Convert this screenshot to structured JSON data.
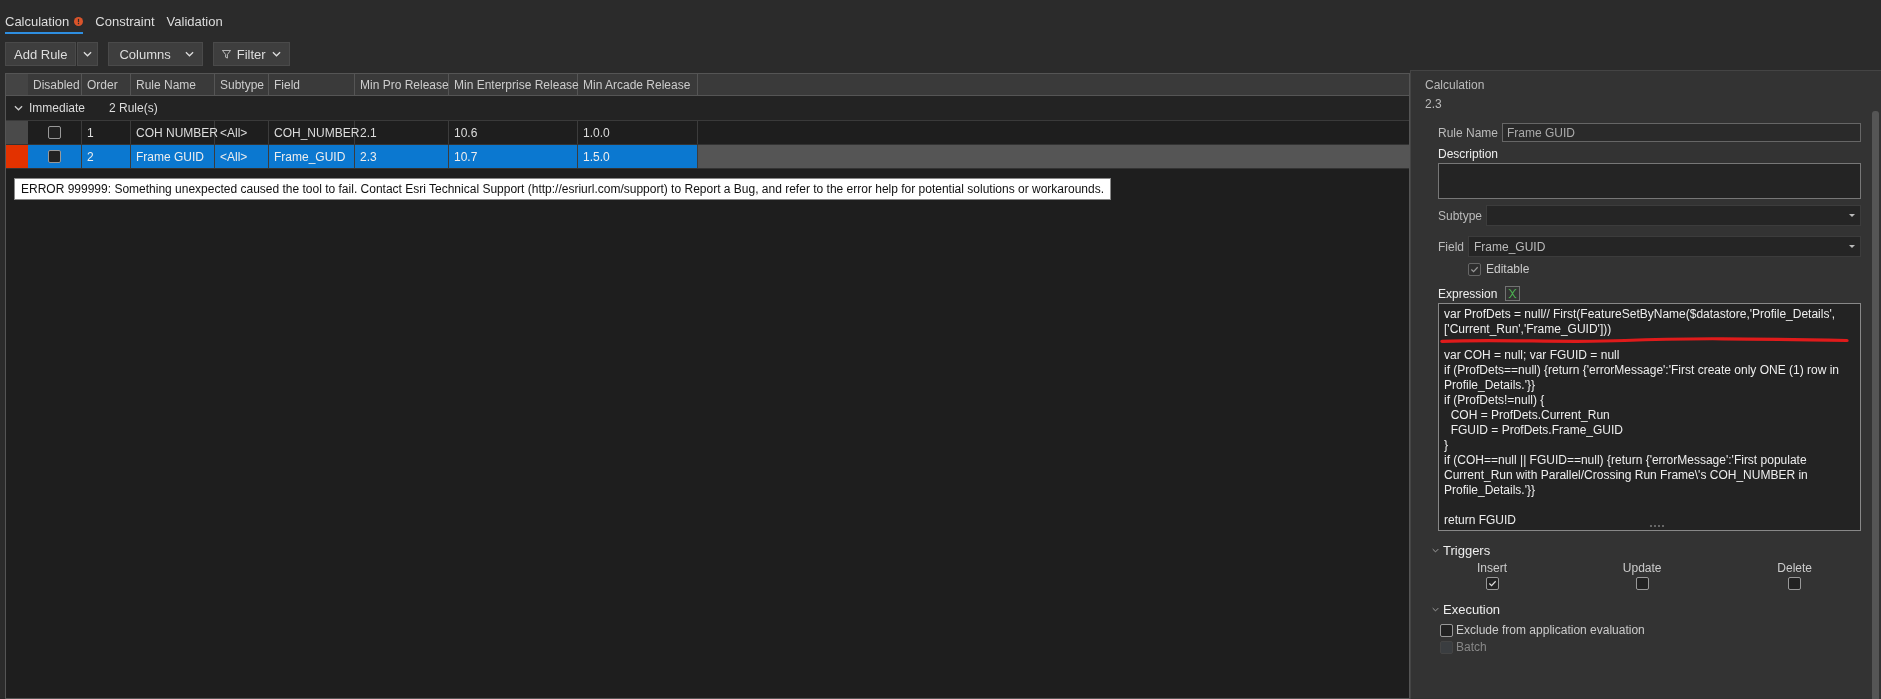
{
  "tabs": [
    {
      "label": "Calculation",
      "selected": true,
      "has_error": true
    },
    {
      "label": "Constraint",
      "selected": false,
      "has_error": false
    },
    {
      "label": "Validation",
      "selected": false,
      "has_error": false
    }
  ],
  "toolbar": [
    {
      "label": "Add Rule",
      "kind": "split"
    },
    {
      "label": "Columns",
      "kind": "dropdown"
    },
    {
      "label": "Filter",
      "kind": "filter"
    }
  ],
  "grid": {
    "checkbox_column": "Disabled",
    "columns": [
      "Order",
      "Rule Name",
      "Subtype",
      "Field",
      "Min Pro Release",
      "Min Enterprise Release",
      "Min Arcade Release"
    ],
    "group": {
      "label": "Immediate",
      "count": "2 Rule(s)",
      "expanded": true
    },
    "rows": [
      {
        "disabled": false,
        "selected": false,
        "error": false,
        "cells": [
          "1",
          "COH NUMBER",
          "<All>",
          "COH_NUMBER",
          "2.1",
          "10.6",
          "1.0.0"
        ]
      },
      {
        "disabled": false,
        "selected": true,
        "error": true,
        "cells": [
          "2",
          "Frame GUID",
          "<All>",
          "Frame_GUID",
          "2.3",
          "10.7",
          "1.5.0"
        ]
      }
    ]
  },
  "tooltip": "ERROR 999999: Something unexpected caused the tool to fail. Contact Esri Technical Support (http://esriurl.com/support) to Report a Bug, and refer to the error help for potential solutions or workarounds.",
  "details": {
    "title": "Calculation",
    "version": "2.3",
    "rule_name_label": "Rule Name",
    "rule_name": "Frame GUID",
    "description_label": "Description",
    "subtype_label": "Subtype",
    "field_label": "Field",
    "field": "Frame_GUID",
    "editable": {
      "label": "Editable",
      "checked": true
    },
    "expression_label": "Expression",
    "expression_blocks": [
      {
        "underlined": true,
        "lines": [
          "var ProfDets = null// First(FeatureSetByName($datastore,'Profile_Details', ['Current_Run','Frame_GUID']))"
        ]
      },
      {
        "underlined": false,
        "lines": [
          "var COH = null; var FGUID = null",
          "if (ProfDets==null) {return {'errorMessage':'First create only ONE (1) row in Profile_Details.'}}",
          "if (ProfDets!=null) {",
          "  COH = ProfDets.Current_Run",
          "  FGUID = ProfDets.Frame_GUID",
          "}",
          "if (COH==null || FGUID==null) {return {'errorMessage':'First populate Current_Run with Parallel/Crossing Run Frame\\'s COH_NUMBER in Profile_Details.'}}"
        ]
      },
      {
        "underlined": false,
        "lines": [
          "return FGUID"
        ]
      }
    ],
    "triggers": {
      "label": "Triggers",
      "expanded": true,
      "items": [
        {
          "label": "Insert",
          "checked": true
        },
        {
          "label": "Update",
          "checked": false
        },
        {
          "label": "Delete",
          "checked": false
        }
      ]
    },
    "execution": {
      "label": "Execution",
      "expanded": true,
      "items": [
        {
          "label": "Exclude from application evaluation",
          "checked": false,
          "disabled": false
        },
        {
          "label": "Batch",
          "checked": false,
          "disabled": true
        }
      ]
    }
  }
}
